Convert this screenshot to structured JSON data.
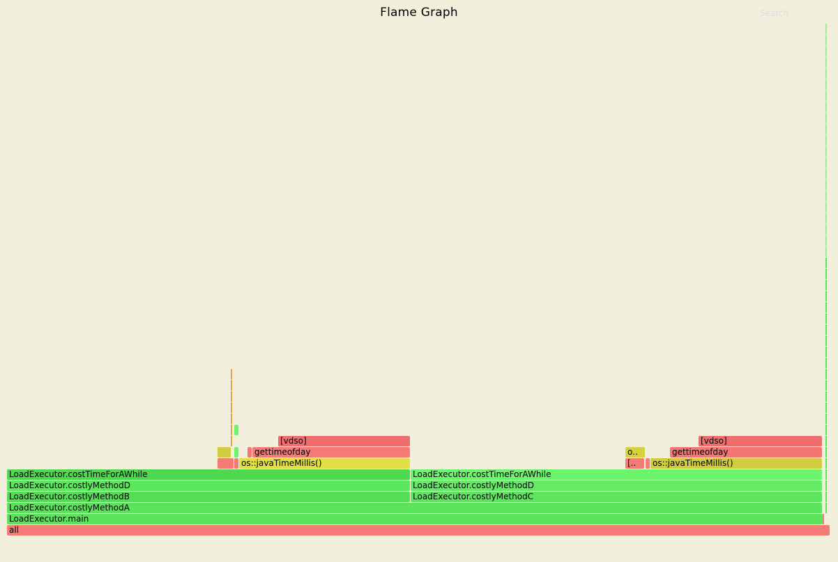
{
  "title": "Flame Graph",
  "search_label": "Search",
  "colors": {
    "background": "#f2f0dc",
    "red": "#f57a78",
    "red_dark": "#ee6e6e",
    "green": "#5ce35c",
    "green_light": "#6cf56c",
    "yellow": "#e1df43",
    "yellow_dark": "#d0cc3e",
    "orange": "#e8a04a"
  },
  "frames": [
    {
      "label": "all",
      "color": "#f57a78"
    },
    {
      "label": "LoadExecutor.main",
      "color": "#5ce35c"
    },
    {
      "label": "LoadExecutor.costlyMethodA",
      "color": "#5ce35c"
    },
    {
      "label": "LoadExecutor.costlyMethodB",
      "color": "#56dd56"
    },
    {
      "label": "LoadExecutor.costlyMethodD",
      "color": "#5ce85c"
    },
    {
      "label": "LoadExecutor.costTimeForAWhile",
      "color": "#4fd84f"
    },
    {
      "label": "os::javaTimeMillis()",
      "color": "#e1df43"
    },
    {
      "label": "gettimeofday",
      "color": "#f47a76"
    },
    {
      "label": "[vdso]",
      "color": "#ee6e6e"
    },
    {
      "label": "LoadExecutor.costlyMethodC",
      "color": "#5fe45f"
    },
    {
      "label": "LoadExecutor.costlyMethodD",
      "color": "#64ea64"
    },
    {
      "label": "LoadExecutor.costTimeForAWhile",
      "color": "#6cf56c"
    },
    {
      "label": "os::javaTimeMillis()",
      "color": "#d0cc3e"
    },
    {
      "label": "gettimeofday",
      "color": "#f27674"
    },
    {
      "label": "[vdso]",
      "color": "#ee6e6e"
    },
    {
      "label": "[..",
      "color": "#f47a76"
    },
    {
      "label": "o..",
      "color": "#d6d23e"
    }
  ],
  "minor_frames": [
    {
      "color": "#f47a76"
    },
    {
      "color": "#d0cc3e"
    },
    {
      "color": "#6cf56c"
    },
    {
      "color": "#6cf56c"
    },
    {
      "color": "#f47a76"
    },
    {
      "color": "#f47a76"
    },
    {
      "color": "#f47a76"
    }
  ]
}
